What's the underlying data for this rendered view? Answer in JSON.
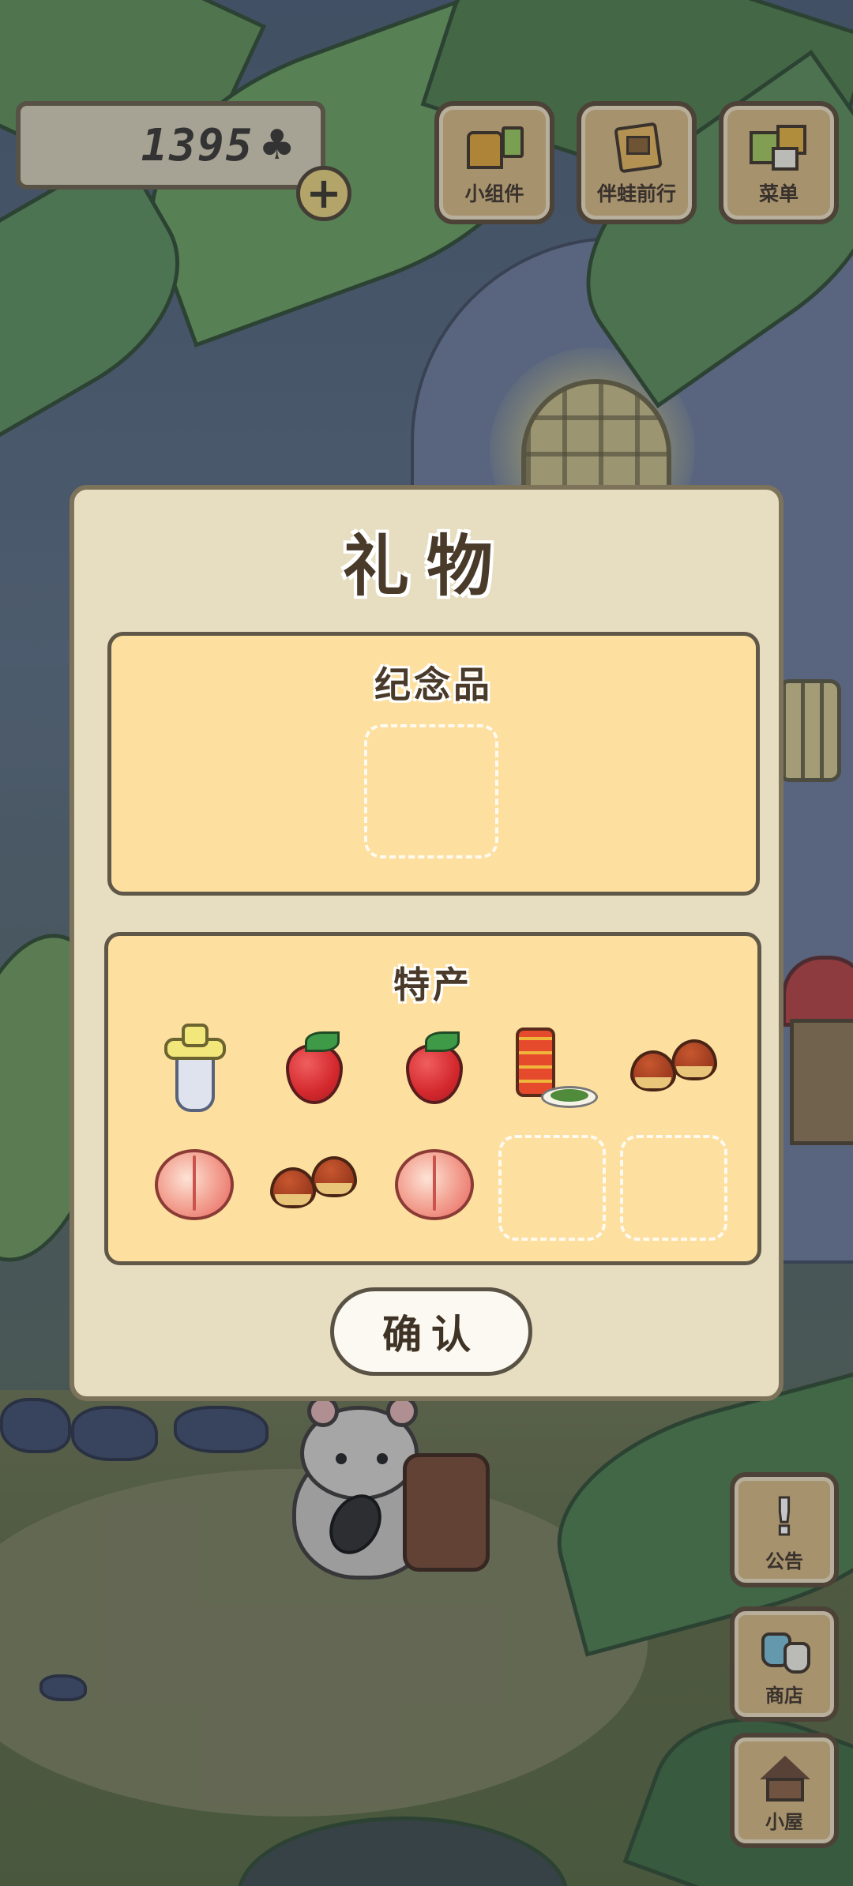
{
  "hud": {
    "clover_count": "1395",
    "clover_icon": "clover-icon",
    "add_icon": "plus-icon"
  },
  "top_buttons": [
    {
      "label": "小组件",
      "icon": "widget-icon"
    },
    {
      "label": "伴蛙前行",
      "icon": "frog-book-icon"
    },
    {
      "label": "菜单",
      "icon": "menu-icon"
    }
  ],
  "side_buttons": [
    {
      "label": "公告",
      "icon": "exclamation-icon"
    },
    {
      "label": "商店",
      "icon": "shop-bags-icon"
    },
    {
      "label": "小屋",
      "icon": "house-icon"
    }
  ],
  "dialog": {
    "title": "礼物",
    "souvenir_section": {
      "title": "纪念品",
      "slots": [
        "empty"
      ]
    },
    "specialty_section": {
      "title": "特产",
      "items": [
        "bottle-gift-icon",
        "strawberry-icon",
        "strawberry-icon",
        "tea-can-icon",
        "chestnuts-icon",
        "peach-icon",
        "chestnuts-icon",
        "peach-icon",
        "empty",
        "empty"
      ]
    },
    "confirm_label": "确认"
  },
  "colors": {
    "panel": "#fddf9f",
    "dialog": "#e7dec1",
    "button_wood": "#d8b982",
    "text": "#4a3a2a"
  }
}
